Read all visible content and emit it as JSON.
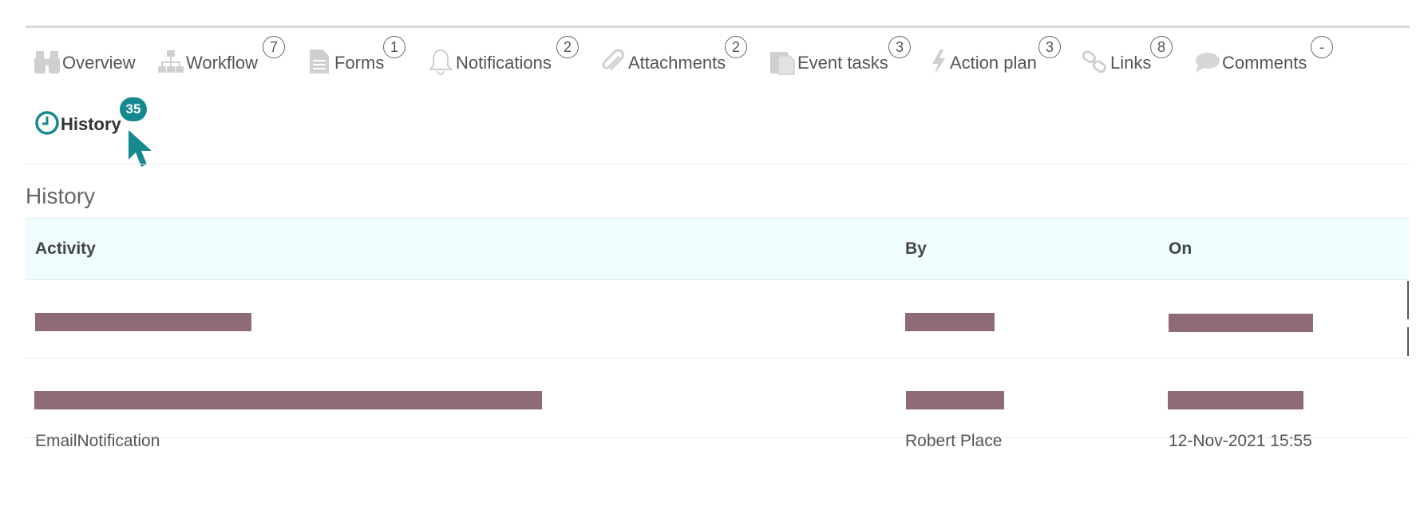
{
  "tabs": [
    {
      "id": "overview",
      "label": "Overview",
      "count": null,
      "icon": "binoculars-icon"
    },
    {
      "id": "workflow",
      "label": "Workflow",
      "count": "7",
      "icon": "org-chart-icon"
    },
    {
      "id": "forms",
      "label": "Forms",
      "count": "1",
      "icon": "document-icon"
    },
    {
      "id": "notifications",
      "label": "Notifications",
      "count": "2",
      "icon": "bell-icon"
    },
    {
      "id": "attachments",
      "label": "Attachments",
      "count": "2",
      "icon": "paperclip-icon"
    },
    {
      "id": "event_tasks",
      "label": "Event tasks",
      "count": "3",
      "icon": "clipboard-icon"
    },
    {
      "id": "action_plan",
      "label": "Action plan",
      "count": "3",
      "icon": "lightning-icon"
    },
    {
      "id": "links",
      "label": "Links",
      "count": "8",
      "icon": "chain-link-icon"
    },
    {
      "id": "comments",
      "label": "Comments",
      "count": "-",
      "icon": "speech-bubble-icon"
    },
    {
      "id": "history",
      "label": "History",
      "count": "35",
      "icon": "clock-icon",
      "active": true
    }
  ],
  "section": {
    "title": "History"
  },
  "table": {
    "columns": [
      "Activity",
      "By",
      "On"
    ],
    "rows": [
      {
        "activity": "",
        "by": "",
        "on": "",
        "redacted": true
      },
      {
        "activity": "",
        "by": "",
        "on": "",
        "redacted": true
      },
      {
        "activity": "EmailNotification",
        "by": "Robert Place",
        "on": "12-Nov-2021 15:55"
      }
    ]
  },
  "colors": {
    "accent": "#15898f",
    "header_bg": "#effdfe",
    "redaction": "#8f6a78"
  }
}
